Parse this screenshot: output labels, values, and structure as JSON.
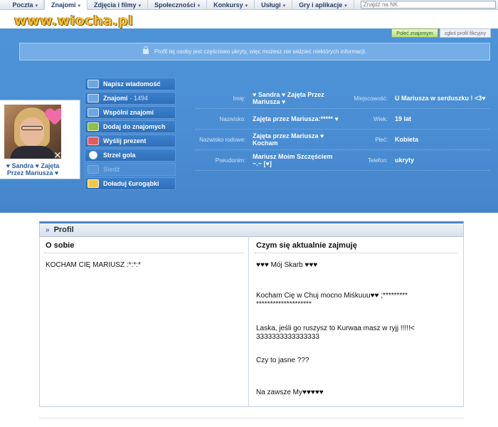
{
  "nav": {
    "items": [
      {
        "label": "Poczta",
        "arrow": "▾"
      },
      {
        "label": "Znajomi",
        "arrow": "▾"
      },
      {
        "label": "Zdjęcia i filmy",
        "arrow": "▾"
      },
      {
        "label": "Społeczności",
        "arrow": "▾"
      },
      {
        "label": "Konkursy",
        "arrow": "▾"
      },
      {
        "label": "Usługi",
        "arrow": "▾"
      },
      {
        "label": "Gry i aplikacje",
        "arrow": "▾"
      }
    ],
    "search_placeholder": "Znajdź na NK"
  },
  "watermark": "www.wiocha.pl",
  "tabs": {
    "recommend": "Poleć znajomym",
    "report": "zgłoś profil fikcyjny"
  },
  "notice": "Profil tej osoby jest częściowo ukryty, więc możesz nie widzieć niektórych informacji.",
  "avatar": {
    "name": "♥ Sandra ♥ Zajęta Przez Mariusza ♥"
  },
  "actions": [
    {
      "label": "Napisz wiadomość",
      "count": ""
    },
    {
      "label": "Znajomi",
      "count": "- 1494"
    },
    {
      "label": "Wspólni znajomi",
      "count": ""
    },
    {
      "label": "Dodaj do znajomych",
      "count": ""
    },
    {
      "label": "Wyślij prezent",
      "count": ""
    },
    {
      "label": "Strzel gola",
      "count": ""
    },
    {
      "label": "Śledź",
      "count": ""
    },
    {
      "label": "Doładuj €urogąbki",
      "count": ""
    }
  ],
  "info": [
    {
      "label": "Imię:",
      "value": "♥ Sandra ♥ Zajęta Przez Mariusza ♥",
      "label2": "Miejscowość:",
      "value2": "U Mariusza w serduszku ! <3♥"
    },
    {
      "label": "Nazwisko:",
      "value": "Zajęta przez Mariusza:***** ♥",
      "label2": "Wiek:",
      "value2": "19 lat"
    },
    {
      "label": "Nazwisko rodowe:",
      "value": "Zajęta przez Mariusza ♥ Kocham",
      "label2": "Płeć:",
      "value2": "Kobieta"
    },
    {
      "label": "Pseudonim:",
      "value": "Mariusz Moim Szczęściem ~.~ [♥]",
      "label2": "Telefon:",
      "value2": "ukryty"
    }
  ],
  "profil": {
    "title": "Profil",
    "about_title": "O sobie",
    "about_text": "KOCHAM CIĘ MARIUSZ :*:*:*",
    "doing_title": "Czym się aktualnie zajmuję",
    "doing_lines": [
      "♥♥♥ Mój Skarb ♥♥♥",
      "Kocham Cię w Chuj mocno Miśkuuu♥♥ ;********* ********************",
      "Laska, jeśli go ruszysz to Kurwaa masz w ryjj !!!!!< 3333333333333333",
      "Czy to jasne ???",
      "Na zawsze My♥♥♥♥♥"
    ]
  }
}
